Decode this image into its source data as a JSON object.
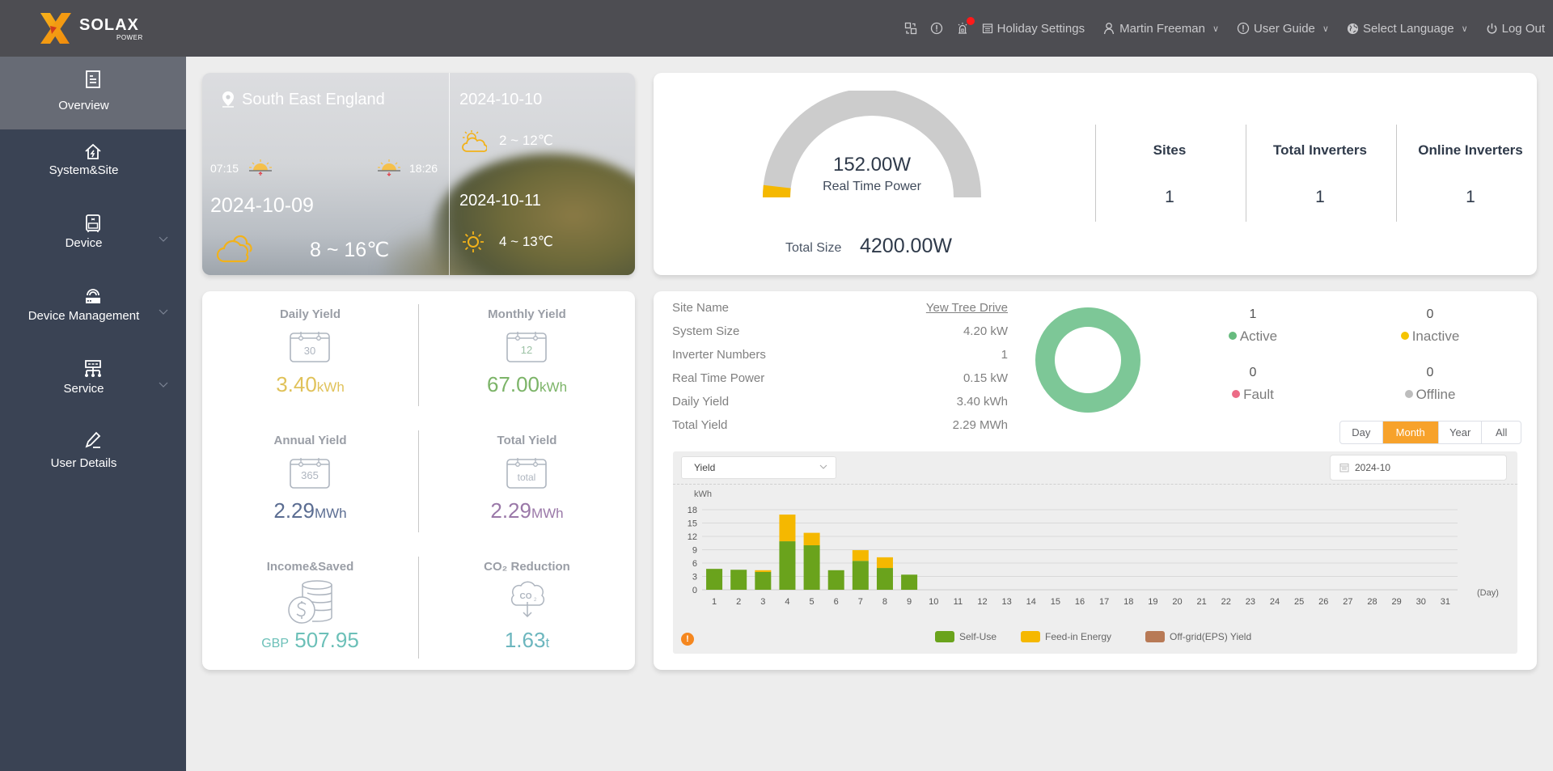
{
  "header": {
    "brand_name": "SOLAX",
    "brand_sub": "POWER",
    "icons": [
      "switch-view-icon",
      "info-icon",
      "alarm-icon"
    ],
    "alarm_badge": "!",
    "holiday_settings": "Holiday Settings",
    "user_name": "Martin Freeman",
    "user_guide": "User Guide",
    "select_language": "Select Language",
    "log_out": "Log Out"
  },
  "sidebar": {
    "items": [
      {
        "label": "Overview",
        "icon": "overview-icon",
        "active": true,
        "has_children": false
      },
      {
        "label": "System&Site",
        "icon": "house-lightning-icon",
        "active": false,
        "has_children": false
      },
      {
        "label": "Device",
        "icon": "device-icon",
        "active": false,
        "has_children": true
      },
      {
        "label": "Device Management",
        "icon": "router-icon",
        "active": false,
        "has_children": true
      },
      {
        "label": "Service",
        "icon": "network-icon",
        "active": false,
        "has_children": true
      },
      {
        "label": "User Details",
        "icon": "pencil-icon",
        "active": false,
        "has_children": false
      }
    ]
  },
  "weather": {
    "location": "South East England",
    "sunrise": "07:15",
    "sunset": "18:26",
    "today": {
      "date": "2024-10-09",
      "temp": "8 ~ 16℃",
      "icon": "cloudy-icon"
    },
    "forecast": [
      {
        "date": "2024-10-10",
        "temp": "2 ~ 12℃",
        "icon": "partly-cloudy-icon"
      },
      {
        "date": "2024-10-11",
        "temp": "4 ~ 13℃",
        "icon": "sunny-icon"
      }
    ]
  },
  "power": {
    "real_time_value": "152.00W",
    "real_time_label": "Real Time Power",
    "gauge_fraction": 0.036,
    "total_size_label": "Total Size",
    "total_size_value": "4200.00W",
    "stats": [
      {
        "title": "Sites",
        "value": "1"
      },
      {
        "title": "Total Inverters",
        "value": "1"
      },
      {
        "title": "Online Inverters",
        "value": "1"
      }
    ],
    "colors": {
      "gauge_fill": "#f5b800",
      "gauge_track": "#cccccc"
    }
  },
  "yields": [
    {
      "title": "Daily Yield",
      "icon_text": "30",
      "value": "3.40",
      "unit": "kWh",
      "color": "#e0c25a"
    },
    {
      "title": "Monthly Yield",
      "icon_text": "12",
      "value": "67.00",
      "unit": "kWh",
      "color": "#7cb468"
    },
    {
      "title": "Annual Yield",
      "icon_text": "365",
      "value": "2.29",
      "unit": "MWh",
      "color": "#5b6d92"
    },
    {
      "title": "Total Yield",
      "icon_text": "total",
      "value": "2.29",
      "unit": "MWh",
      "color": "#9a78a8"
    },
    {
      "title": "Income&Saved",
      "icon_text": "",
      "prefix": "GBP",
      "value": "507.95",
      "unit": "",
      "color": "#6cc0b8"
    },
    {
      "title": "CO₂ Reduction",
      "icon_text": "CO2",
      "value": "1.63",
      "unit": "t",
      "color": "#6cb6be"
    }
  ],
  "site": {
    "rows": [
      {
        "label": "Site Name",
        "value": "Yew Tree Drive",
        "link": true
      },
      {
        "label": "System Size",
        "value": "4.20 kW",
        "link": false
      },
      {
        "label": "Inverter Numbers",
        "value": "1",
        "link": false
      },
      {
        "label": "Real Time Power",
        "value": "0.15 kW",
        "link": false
      },
      {
        "label": "Daily Yield",
        "value": "3.40 kWh",
        "link": false
      },
      {
        "label": "Total Yield",
        "value": "2.29 MWh",
        "link": false
      }
    ],
    "status": [
      {
        "label": "Active",
        "count": "1",
        "color": "#66bb7e"
      },
      {
        "label": "Inactive",
        "count": "0",
        "color": "#f5c400"
      },
      {
        "label": "Fault",
        "count": "0",
        "color": "#ec6b86"
      },
      {
        "label": "Offline",
        "count": "0",
        "color": "#bdbdbd"
      }
    ],
    "donut_color": "#7dc797",
    "period_tabs": [
      {
        "label": "Day",
        "active": false
      },
      {
        "label": "Month",
        "active": true
      },
      {
        "label": "Year",
        "active": false
      },
      {
        "label": "All",
        "active": false
      }
    ],
    "metric_select": "Yield",
    "date_value": "2024-10"
  },
  "chart_data": {
    "type": "bar",
    "stacked": true,
    "title": "",
    "xlabel": "(Day)",
    "ylabel": "kWh",
    "ylim": [
      0,
      18
    ],
    "yticks": [
      0,
      3,
      6,
      9,
      12,
      15,
      18
    ],
    "grid": true,
    "legend_position": "bottom",
    "categories": [
      "1",
      "2",
      "3",
      "4",
      "5",
      "6",
      "7",
      "8",
      "9",
      "10",
      "11",
      "12",
      "13",
      "14",
      "15",
      "16",
      "17",
      "18",
      "19",
      "20",
      "21",
      "22",
      "23",
      "24",
      "25",
      "26",
      "27",
      "28",
      "29",
      "30",
      "31"
    ],
    "series": [
      {
        "name": "Self-Use",
        "color": "#6aa31c",
        "values": [
          4.7,
          4.5,
          4.0,
          10.9,
          10.0,
          4.4,
          6.5,
          4.9,
          3.4,
          0,
          0,
          0,
          0,
          0,
          0,
          0,
          0,
          0,
          0,
          0,
          0,
          0,
          0,
          0,
          0,
          0,
          0,
          0,
          0,
          0,
          0
        ]
      },
      {
        "name": "Feed-in Energy",
        "color": "#f5b800",
        "values": [
          0,
          0,
          0.4,
          6.0,
          2.8,
          0,
          2.4,
          2.4,
          0,
          0,
          0,
          0,
          0,
          0,
          0,
          0,
          0,
          0,
          0,
          0,
          0,
          0,
          0,
          0,
          0,
          0,
          0,
          0,
          0,
          0,
          0
        ]
      },
      {
        "name": "Off-grid(EPS) Yield",
        "color": "#b87a56",
        "values": [
          0,
          0,
          0,
          0,
          0,
          0,
          0,
          0,
          0,
          0,
          0,
          0,
          0,
          0,
          0,
          0,
          0,
          0,
          0,
          0,
          0,
          0,
          0,
          0,
          0,
          0,
          0,
          0,
          0,
          0,
          0
        ]
      }
    ]
  }
}
